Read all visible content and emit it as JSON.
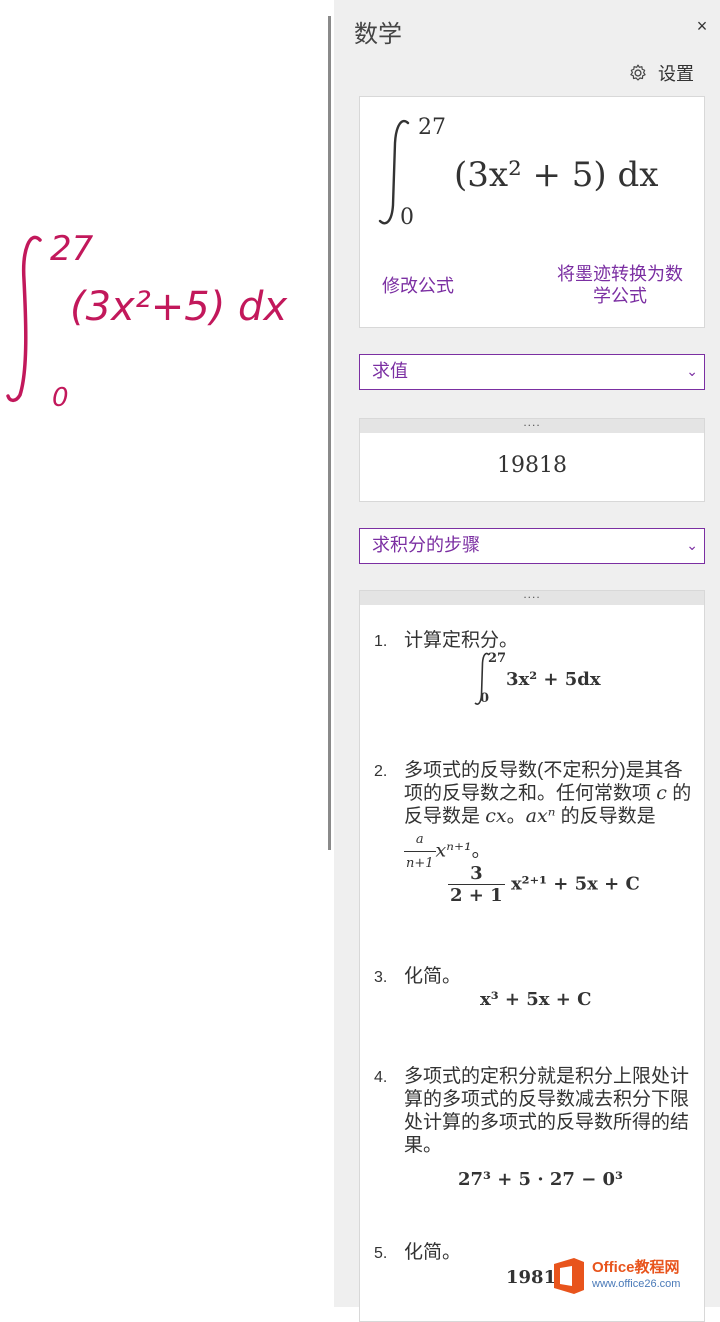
{
  "pane": {
    "title": "数学",
    "close": "×",
    "settings_label": "设置"
  },
  "formula": {
    "lower": "0",
    "upper": "27",
    "expression": "(3x² + 5) dx",
    "edit_link": "修改公式",
    "convert_link_line1": "将墨迹转换为数",
    "convert_link_line2": "学公式"
  },
  "action_select": {
    "value": "求值"
  },
  "result": {
    "value": "19818"
  },
  "steps_select": {
    "value": "求积分的步骤"
  },
  "steps": [
    {
      "num": "1.",
      "text": "计算定积分。"
    },
    {
      "num": "2.",
      "text_a": "多项式的反导数(不定积分)是其各项的反导数之和。任何常数项 ",
      "var_c": "c",
      "text_b": " 的反导数是 ",
      "var_cx": "cx",
      "text_c": "。",
      "var_axn": "axⁿ",
      "text_d": " 的反导数是",
      "frac_num": "a",
      "frac_den": "n+1",
      "var_tail": "xⁿ⁺¹",
      "text_e": "。"
    },
    {
      "num": "3.",
      "text": "化简。"
    },
    {
      "num": "4.",
      "text": "多项式的定积分就是积分上限处计算的多项式的反导数减去积分下限处计算的多项式的反导数所得的结果。"
    },
    {
      "num": "5.",
      "text": "化简。"
    }
  ],
  "step_math": {
    "s1_upper": "27",
    "s1_lower": "0",
    "s1_expr": "3x² + 5dx",
    "s2_num": "3",
    "s2_den": "2 + 1",
    "s2_rest": "x²⁺¹ + 5x + C",
    "s3": "x³ + 5x + C",
    "s4": "27³ + 5 · 27 − 0³",
    "s5": "19818"
  },
  "ink": {
    "upper": "27",
    "lower": "0",
    "expression": "(3x²+5) dx"
  },
  "watermark": {
    "brand": "Office教程网",
    "url": "www.office26.com"
  },
  "colors": {
    "accent": "#7b2fa2",
    "ink": "#c2185b"
  }
}
